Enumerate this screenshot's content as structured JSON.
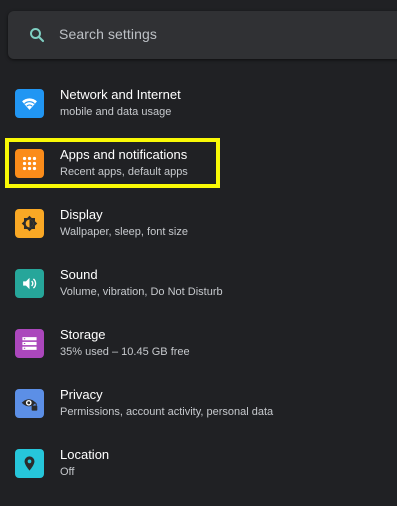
{
  "search": {
    "placeholder": "Search settings"
  },
  "settings_items": [
    {
      "title": "Network and Internet",
      "subtitle": "mobile and data usage",
      "icon": "wifi-icon",
      "color": "#2196f3"
    },
    {
      "title": "Apps and notifications",
      "subtitle": "Recent apps, default apps",
      "icon": "apps-grid-icon",
      "color": "#fb8c1a"
    },
    {
      "title": "Display",
      "subtitle": "Wallpaper, sleep, font size",
      "icon": "brightness-icon",
      "color": "#f9a825"
    },
    {
      "title": "Sound",
      "subtitle": "Volume, vibration, Do Not Disturb",
      "icon": "volume-icon",
      "color": "#26a69a"
    },
    {
      "title": "Storage",
      "subtitle": "35% used – 10.45 GB free",
      "icon": "storage-icon",
      "color": "#ab47bc"
    },
    {
      "title": "Privacy",
      "subtitle": "Permissions, account activity, personal data",
      "icon": "privacy-eye-icon",
      "color": "#5c8fe6"
    },
    {
      "title": "Location",
      "subtitle": "Off",
      "icon": "location-pin-icon",
      "color": "#26c6da"
    }
  ],
  "colors": {
    "background": "#202124",
    "search_bar": "#303134",
    "accent_search_icon": "#7fcfc2",
    "highlight": "#f9f906"
  }
}
